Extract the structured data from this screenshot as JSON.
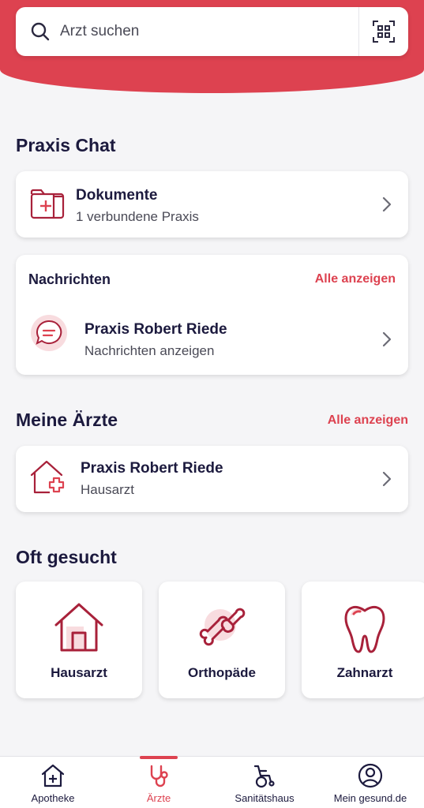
{
  "search": {
    "placeholder": "Arzt suchen"
  },
  "praxis_chat": {
    "title": "Praxis Chat",
    "documents": {
      "title": "Dokumente",
      "subtitle": "1 verbundene Praxis"
    },
    "messages": {
      "title": "Nachrichten",
      "show_all": "Alle anzeigen",
      "item": {
        "name": "Praxis Robert Riede",
        "subtitle": "Nachrichten anzeigen"
      }
    }
  },
  "my_doctors": {
    "title": "Meine Ärzte",
    "show_all": "Alle anzeigen",
    "item": {
      "name": "Praxis Robert Riede",
      "subtitle": "Hausarzt"
    }
  },
  "often_searched": {
    "title": "Oft gesucht",
    "tiles": [
      {
        "label": "Hausarzt",
        "icon": "house-icon"
      },
      {
        "label": "Orthopäde",
        "icon": "bone-icon"
      },
      {
        "label": "Zahnarzt",
        "icon": "tooth-icon"
      }
    ]
  },
  "tabbar": {
    "tabs": [
      {
        "label": "Apotheke",
        "icon": "pharmacy-icon",
        "active": false
      },
      {
        "label": "Ärzte",
        "icon": "stethoscope-icon",
        "active": true
      },
      {
        "label": "Sanitätshaus",
        "icon": "wheelchair-icon",
        "active": false
      },
      {
        "label": "Mein gesund.de",
        "icon": "profile-icon",
        "active": false
      }
    ]
  },
  "colors": {
    "accent": "#dd4250",
    "text": "#1c1a3e",
    "muted": "#4a4a56",
    "icon": "#a8213a",
    "background": "#f5f5f7"
  }
}
